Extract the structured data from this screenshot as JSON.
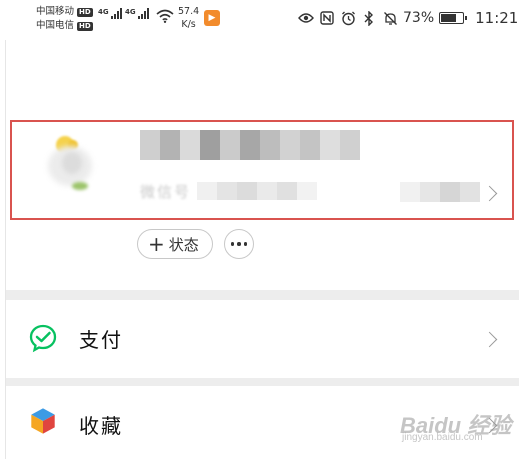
{
  "status_bar": {
    "carrier_1": "中国移动",
    "carrier_2": "中国电信",
    "hd_label": "HD",
    "network_1": "4G",
    "network_2": "4G",
    "speed_value": "57.4",
    "speed_unit": "K/s",
    "battery_percent": "73%",
    "battery_level": 0.73,
    "time": "11:21"
  },
  "profile": {
    "wechat_id_label": "微信号"
  },
  "status_actions": {
    "add_status_label": "+ 状态",
    "add_status_text": "状态"
  },
  "menu": {
    "items": [
      {
        "label": "支付",
        "icon": "wechat-pay-icon"
      },
      {
        "label": "收藏",
        "icon": "favorites-cube-icon"
      }
    ]
  },
  "watermark": {
    "text": "Baidu 经验",
    "url": "jingyan.baidu.com"
  },
  "colors": {
    "highlight_border": "#d9534f",
    "pay_green": "#07c160",
    "divider": "#ededed"
  }
}
